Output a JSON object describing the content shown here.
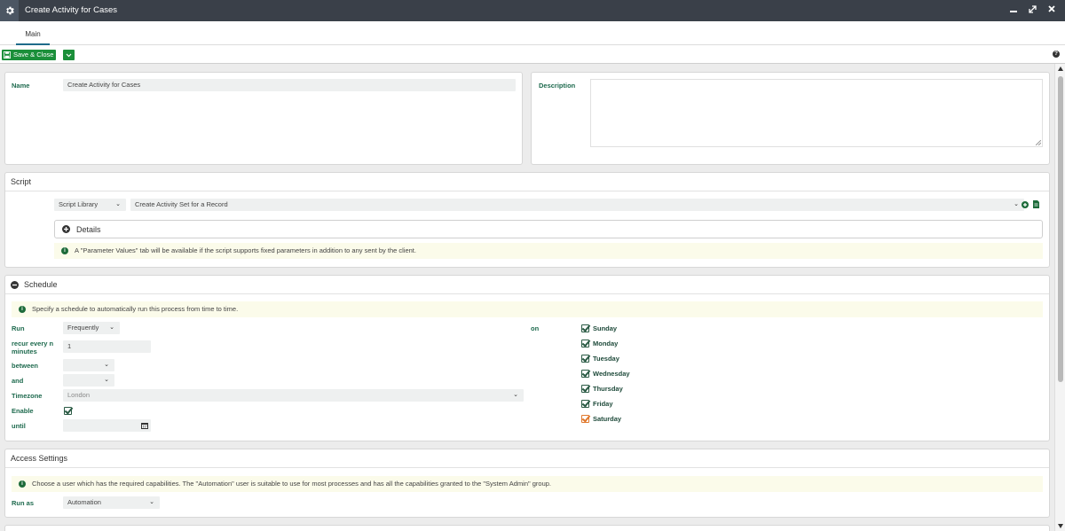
{
  "window": {
    "title": "Create Activity for Cases",
    "app_icon": "gear-icon",
    "controls": [
      "minimize-icon",
      "restore-icon",
      "close-icon"
    ]
  },
  "tabs": [
    {
      "label": "Main",
      "active": true
    }
  ],
  "toolbar": {
    "save_label": "Save & Close",
    "help_label": "?"
  },
  "general": {
    "name_label": "Name",
    "name_value": "Create Activity for Cases",
    "description_label": "Description",
    "description_value": ""
  },
  "script": {
    "title": "Script",
    "library_value": "Script Library",
    "script_value": "Create Activity Set for a Record",
    "details_label": "Details",
    "notice": "A \"Parameter Values\" tab will be available if the script supports fixed parameters in addition to any sent by the client."
  },
  "schedule": {
    "title": "Schedule",
    "notice": "Specify a schedule to automatically run this process from time to time.",
    "run_label": "Run",
    "run_value": "Frequently",
    "recur_label": "recur every n minutes",
    "recur_value": "1",
    "between_label": "between",
    "between_value": "",
    "and_label": "and",
    "and_value": "",
    "timezone_label": "Timezone",
    "timezone_value": "London",
    "enable_label": "Enable",
    "enable_checked": true,
    "until_label": "until",
    "until_value": "",
    "on_label": "on",
    "days": [
      {
        "label": "Sunday",
        "checked": true
      },
      {
        "label": "Monday",
        "checked": true
      },
      {
        "label": "Tuesday",
        "checked": true
      },
      {
        "label": "Wednesday",
        "checked": true
      },
      {
        "label": "Thursday",
        "checked": true
      },
      {
        "label": "Friday",
        "checked": true
      },
      {
        "label": "Saturday",
        "checked": true,
        "highlight": true
      }
    ]
  },
  "access": {
    "title": "Access Settings",
    "notice": "Choose a user which has the required capabilities. The \"Automation\" user is suitable to use for most processes and has all the capabilities granted to the \"System Admin\" group.",
    "run_as_label": "Run as",
    "run_as_value": "Automation"
  },
  "colors": {
    "titlebar": "#3a4049",
    "save_button": "#1b8f3a",
    "label_green": "#1e6a4e",
    "saturday_check": "#e0782c"
  }
}
